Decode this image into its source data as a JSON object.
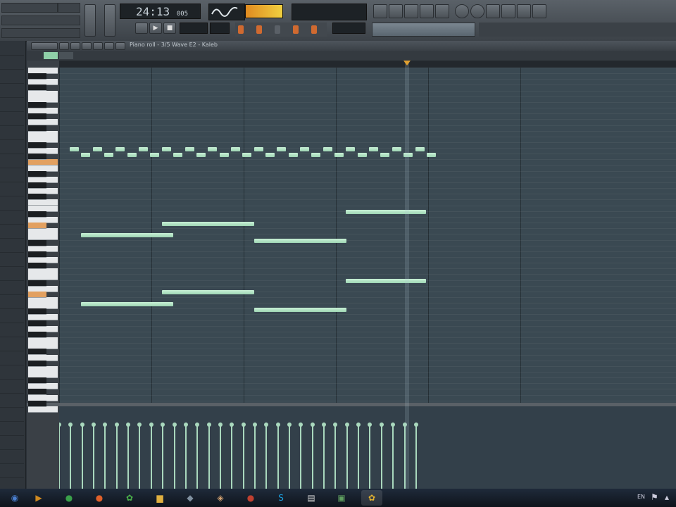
{
  "toolbar": {
    "time_display": "24:13",
    "time_subscript": "005"
  },
  "piano_roll": {
    "title": "Piano roll - 3/5 Wave E2 - Kaleb"
  },
  "taskbar": {
    "language": "EN",
    "apps": [
      {
        "icon": "start-orb-icon",
        "glyph": "◉",
        "color": "#4a7fd0"
      },
      {
        "icon": "media-player-icon",
        "glyph": "▶",
        "color": "#d08a20"
      },
      {
        "icon": "chrome-icon",
        "glyph": "●",
        "color": "#3aa04a"
      },
      {
        "icon": "firefox-icon",
        "glyph": "●",
        "color": "#e0602a"
      },
      {
        "icon": "fl-studio-icon",
        "glyph": "✿",
        "color": "#4ab04a"
      },
      {
        "icon": "folder-icon",
        "glyph": "▆",
        "color": "#e0b040"
      },
      {
        "icon": "app-icon",
        "glyph": "◆",
        "color": "#8090a0"
      },
      {
        "icon": "paint-icon",
        "glyph": "◈",
        "color": "#d0a070"
      },
      {
        "icon": "media-icon",
        "glyph": "●",
        "color": "#c04030"
      },
      {
        "icon": "skype-icon",
        "glyph": "S",
        "color": "#1aa0e0"
      },
      {
        "icon": "document-icon",
        "glyph": "▤",
        "color": "#d0d0d0"
      },
      {
        "icon": "image-editor-icon",
        "glyph": "▣",
        "color": "#60a060"
      },
      {
        "icon": "fl-active-icon",
        "glyph": "✿",
        "color": "#e0b030"
      }
    ]
  },
  "chart_data": {
    "type": "piano-roll",
    "grid_steps": 20,
    "notes": [
      {
        "row": 11,
        "start": 0.0,
        "len": 0.5
      },
      {
        "row": 11,
        "start": 1.0,
        "len": 0.5
      },
      {
        "row": 11,
        "start": 2.0,
        "len": 0.5
      },
      {
        "row": 11,
        "start": 3.0,
        "len": 0.5
      },
      {
        "row": 11,
        "start": 4.0,
        "len": 0.5
      },
      {
        "row": 11,
        "start": 5.0,
        "len": 0.5
      },
      {
        "row": 11,
        "start": 6.0,
        "len": 0.5
      },
      {
        "row": 11,
        "start": 7.0,
        "len": 0.5
      },
      {
        "row": 11,
        "start": 8.0,
        "len": 0.5
      },
      {
        "row": 11,
        "start": 9.0,
        "len": 0.5
      },
      {
        "row": 11,
        "start": 10.0,
        "len": 0.5
      },
      {
        "row": 11,
        "start": 11.0,
        "len": 0.5
      },
      {
        "row": 11,
        "start": 12.0,
        "len": 0.5
      },
      {
        "row": 11,
        "start": 13.0,
        "len": 0.5
      },
      {
        "row": 11,
        "start": 14.0,
        "len": 0.5
      },
      {
        "row": 11,
        "start": 15.0,
        "len": 0.5
      },
      {
        "row": 12,
        "start": 0.5,
        "len": 0.5
      },
      {
        "row": 12,
        "start": 1.5,
        "len": 0.5
      },
      {
        "row": 12,
        "start": 2.5,
        "len": 0.5
      },
      {
        "row": 12,
        "start": 3.5,
        "len": 0.5
      },
      {
        "row": 12,
        "start": 4.5,
        "len": 0.5
      },
      {
        "row": 12,
        "start": 5.5,
        "len": 0.5
      },
      {
        "row": 12,
        "start": 6.5,
        "len": 0.5
      },
      {
        "row": 12,
        "start": 7.5,
        "len": 0.5
      },
      {
        "row": 12,
        "start": 8.5,
        "len": 0.5
      },
      {
        "row": 12,
        "start": 9.5,
        "len": 0.5
      },
      {
        "row": 12,
        "start": 10.5,
        "len": 0.5
      },
      {
        "row": 12,
        "start": 11.5,
        "len": 0.5
      },
      {
        "row": 12,
        "start": 12.5,
        "len": 0.5
      },
      {
        "row": 12,
        "start": 13.5,
        "len": 0.5
      },
      {
        "row": 12,
        "start": 14.5,
        "len": 0.5
      },
      {
        "row": 12,
        "start": 15.5,
        "len": 0.5
      },
      {
        "row": 22,
        "start": 12.0,
        "len": 3.5
      },
      {
        "row": 24,
        "start": 4.0,
        "len": 4.0
      },
      {
        "row": 26,
        "start": 0.5,
        "len": 4.0
      },
      {
        "row": 27,
        "start": 8.0,
        "len": 4.0
      },
      {
        "row": 34,
        "start": 12.0,
        "len": 3.5
      },
      {
        "row": 36,
        "start": 4.0,
        "len": 4.0
      },
      {
        "row": 38,
        "start": 0.5,
        "len": 4.0
      },
      {
        "row": 39,
        "start": 8.0,
        "len": 4.0
      }
    ],
    "velocity_stems": 32
  }
}
